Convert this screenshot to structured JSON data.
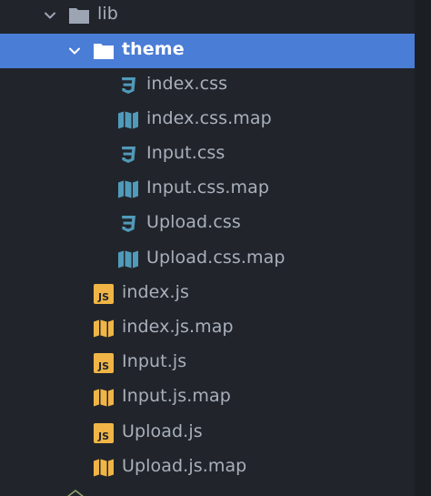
{
  "tree": {
    "items": [
      {
        "label": "lib",
        "kind": "folder",
        "expanded": true,
        "selected": false,
        "depth": 0
      },
      {
        "label": "theme",
        "kind": "folder",
        "expanded": true,
        "selected": true,
        "depth": 1
      },
      {
        "label": "index.css",
        "kind": "css",
        "selected": false,
        "depth": 2
      },
      {
        "label": "index.css.map",
        "kind": "map",
        "selected": false,
        "depth": 2
      },
      {
        "label": "Input.css",
        "kind": "css",
        "selected": false,
        "depth": 2
      },
      {
        "label": "Input.css.map",
        "kind": "map",
        "selected": false,
        "depth": 2
      },
      {
        "label": "Upload.css",
        "kind": "css",
        "selected": false,
        "depth": 2
      },
      {
        "label": "Upload.css.map",
        "kind": "map",
        "selected": false,
        "depth": 2
      },
      {
        "label": "index.js",
        "kind": "js",
        "selected": false,
        "depth": 1
      },
      {
        "label": "index.js.map",
        "kind": "map-js",
        "selected": false,
        "depth": 1
      },
      {
        "label": "Input.js",
        "kind": "js",
        "selected": false,
        "depth": 1
      },
      {
        "label": "Input.js.map",
        "kind": "map-js",
        "selected": false,
        "depth": 1
      },
      {
        "label": "Upload.js",
        "kind": "js",
        "selected": false,
        "depth": 1
      },
      {
        "label": "Upload.js.map",
        "kind": "map-js",
        "selected": false,
        "depth": 1
      }
    ],
    "icons": {
      "folder": "folder-icon",
      "css": "css3-icon",
      "map": "map-icon",
      "map-js": "map-icon",
      "js": "js-file-icon"
    },
    "colors": {
      "background": "#21252b",
      "selection": "#4a7dd6",
      "text": "#a9b0bc",
      "selected_text": "#ffffff",
      "folder": "#9da5b4",
      "css_icon": "#519aba",
      "map_css_icon": "#519aba",
      "map_js_icon": "#f0b546",
      "js_icon": "#f0b546"
    },
    "js_badge_text": "JS"
  }
}
